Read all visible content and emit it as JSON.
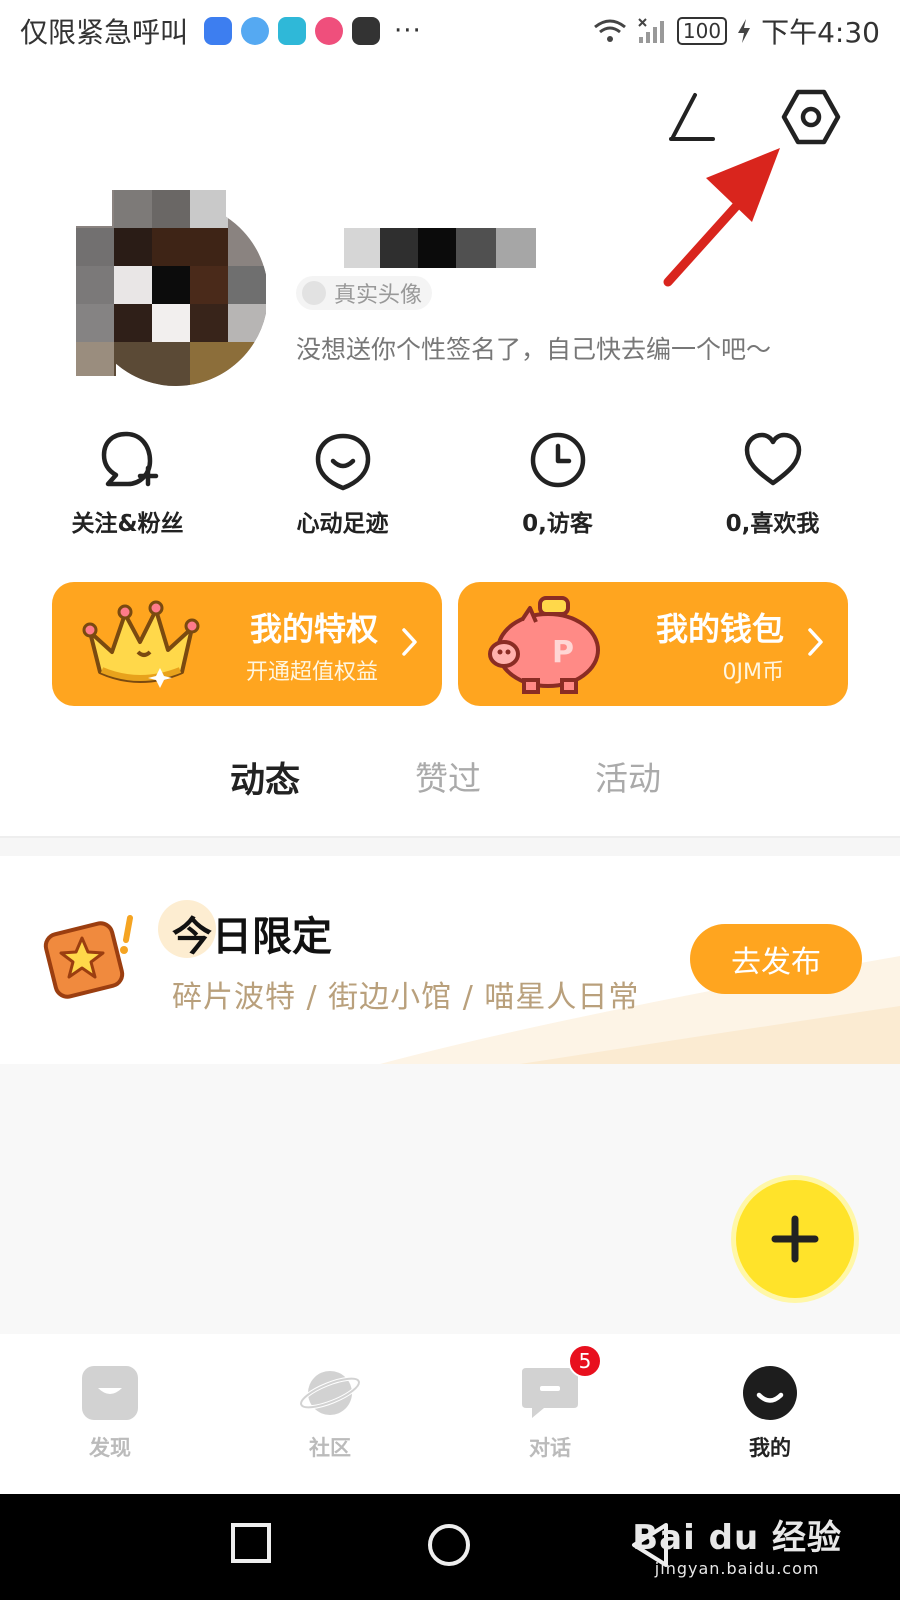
{
  "status_bar": {
    "carrier_text": "仅限紧急呼叫",
    "more": "···",
    "battery": "100",
    "time": "下午4:30"
  },
  "header": {
    "edit_icon": "edit-icon",
    "settings_icon": "settings-hexagon-icon"
  },
  "profile": {
    "verify_label": "真实头像",
    "signature": "没想送你个性签名了，自己快去编一个吧～"
  },
  "stats": [
    {
      "icon": "user-add-icon",
      "label": "关注&粉丝"
    },
    {
      "icon": "heart-face-icon",
      "label": "心动足迹"
    },
    {
      "icon": "clock-icon",
      "label": "0,访客"
    },
    {
      "icon": "heart-icon",
      "label": "0,喜欢我"
    }
  ],
  "cards": {
    "privilege": {
      "title": "我的特权",
      "subtitle": "开通超值权益"
    },
    "wallet": {
      "title": "我的钱包",
      "subtitle": "0JM币"
    }
  },
  "tabs": [
    {
      "label": "动态",
      "active": true
    },
    {
      "label": "赞过",
      "active": false
    },
    {
      "label": "活动",
      "active": false
    }
  ],
  "promo": {
    "title": "今日限定",
    "tags": "碎片波特 / 街边小馆 / 喵星人日常",
    "button": "去发布"
  },
  "bottom_nav": [
    {
      "label": "发现",
      "icon": "discover-face-icon",
      "active": false
    },
    {
      "label": "社区",
      "icon": "planet-icon",
      "active": false
    },
    {
      "label": "对话",
      "icon": "chat-bubble-icon",
      "active": false,
      "badge": "5"
    },
    {
      "label": "我的",
      "icon": "profile-smile-icon",
      "active": true
    }
  ],
  "watermark": {
    "logo": "Bai du 经验",
    "url": "jingyan.baidu.com"
  },
  "colors": {
    "accent": "#ffa51f",
    "fab": "#ffe32a",
    "badge": "#e8101e",
    "annotation_arrow": "#d9251d"
  }
}
